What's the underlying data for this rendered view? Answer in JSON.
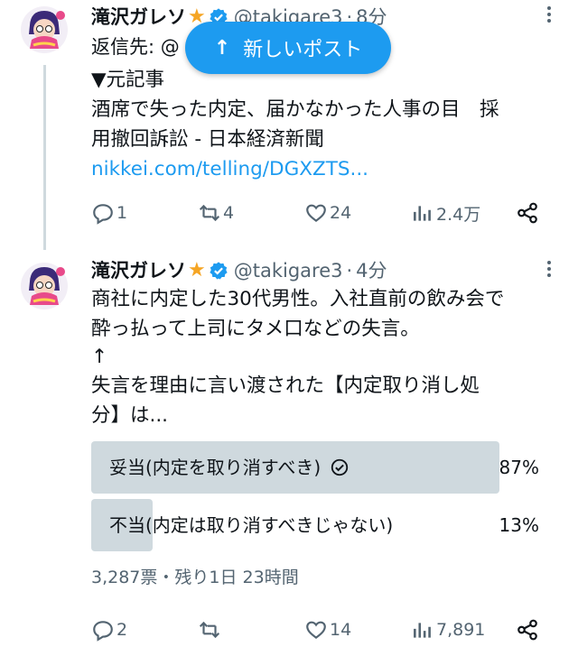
{
  "new_posts_pill": {
    "arrow": "↑",
    "label": "新しいポスト"
  },
  "tweet1": {
    "name": "滝沢ガレソ",
    "star": "★",
    "handle": "@takigare3",
    "sep": "·",
    "time": "8分",
    "reply_prefix": "返信先: @",
    "lines": [
      "▼元記事",
      "酒席で失った内定、届かなかった人事の目　採",
      "用撤回訴訟 - 日本経済新聞"
    ],
    "link": "nikkei.com/telling/DGXZTS...",
    "stats": {
      "replies": "1",
      "retweets": "4",
      "likes": "24",
      "views": "2.4万"
    }
  },
  "tweet2": {
    "name": "滝沢ガレソ",
    "star": "★",
    "handle": "@takigare3",
    "sep": "·",
    "time": "4分",
    "lines": [
      "商社に内定した30代男性。入社直前の飲み会で",
      "酔っ払って上司にタメ口などの失言。",
      "↑",
      "失言を理由に言い渡された【内定取り消し処",
      "分】は..."
    ],
    "poll": {
      "options": [
        {
          "label": "妥当(内定を取り消すべき)",
          "percent": "87%",
          "fraction": 0.87,
          "chosen": true
        },
        {
          "label": "不当(内定は取り消すべきじゃない)",
          "percent": "13%",
          "fraction": 0.13,
          "chosen": false
        }
      ],
      "meta": "3,287票・残り1日 23時間"
    },
    "stats": {
      "replies": "2",
      "retweets": "",
      "likes": "14",
      "views": "7,891"
    }
  },
  "colors": {
    "accent": "#1d9bf0",
    "muted": "#536471",
    "poll_bar": "#cfd9de",
    "star": "#f5a524"
  },
  "icons": [
    "avatar",
    "star-icon",
    "verified-icon",
    "more-icon",
    "reply-icon",
    "retweet-icon",
    "like-icon",
    "views-icon",
    "share-icon",
    "check-circle-icon",
    "arrow-up-icon"
  ]
}
